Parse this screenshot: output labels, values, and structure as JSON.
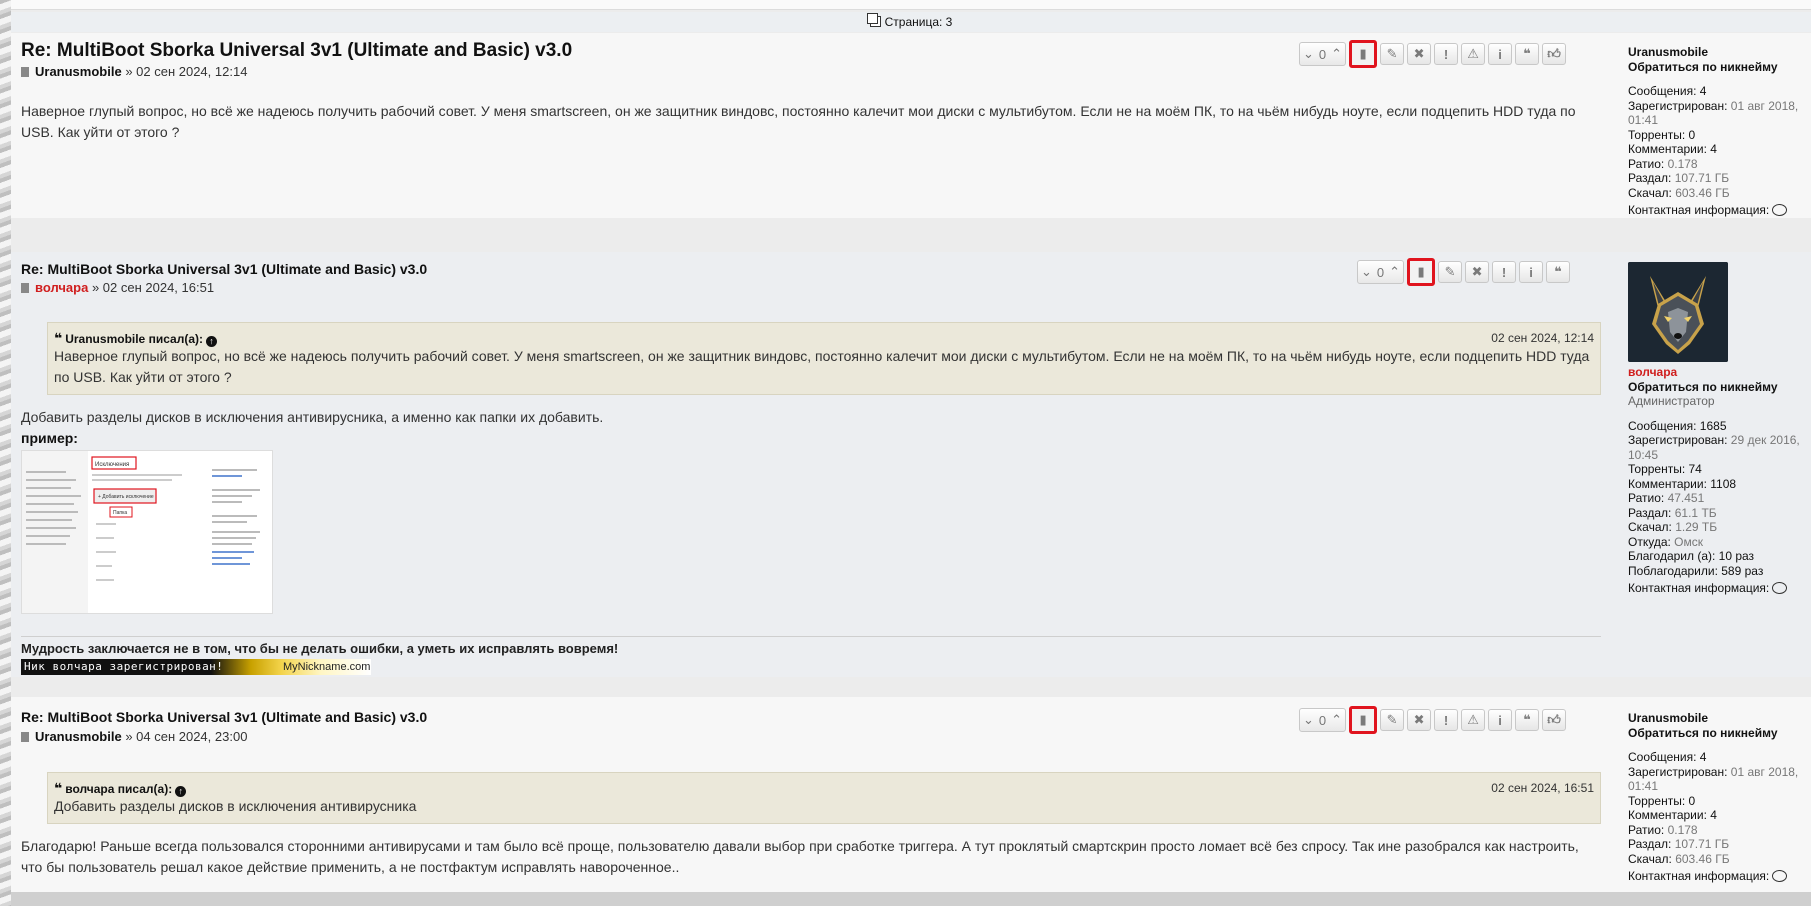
{
  "pagination": {
    "label": "Страница: 3"
  },
  "posts": [
    {
      "title": "Re: MultiBoot Sborka Universal 3v1 (Ultimate and Basic) v3.0",
      "author": "Uranusmobile",
      "date": "» 02 сен 2024, 12:14",
      "vote_count": "0",
      "body": "Наверное глупый вопрос, но всё же надеюсь получить рабочий совет. У меня smartscreen, он же защитник виндовс, постоянно калечит мои диски с мультибутом. Если не на моём ПК, то на чьём нибудь ноуте, если подцепить HDD туда по USB. Как уйти от этого ?",
      "profile": {
        "username": "Uranusmobile",
        "contact_by_nick": "Обратиться по никнейму",
        "messages": "Сообщения: 4",
        "registered_label": "Зарегистрирован:",
        "registered_value": "01 авг 2018, 01:41",
        "torrents": "Торренты: 0",
        "comments": "Комментарии: 4",
        "ratio_label": "Ратио:",
        "ratio_value": "0.178",
        "upload_label": "Раздал:",
        "upload_value": "107.71 ГБ",
        "download_label": "Скачал:",
        "download_value": "603.46 ГБ",
        "contact_info": "Контактная информация:"
      }
    },
    {
      "title": "Re: MultiBoot Sborka Universal 3v1 (Ultimate and Basic) v3.0",
      "author": "волчара",
      "date": "» 02 сен 2024, 16:51",
      "vote_count": "0",
      "quote": {
        "author": "Uranusmobile",
        "wrote": "писал(а):",
        "date": "02 сен 2024, 12:14",
        "text": "Наверное глупый вопрос, но всё же надеюсь получить рабочий совет. У меня smartscreen, он же защитник виндовс, постоянно калечит мои диски с мультибутом. Если не на моём ПК, то на чьём нибудь ноуте, если подцепить HDD туда по USB. Как уйти от этого ?"
      },
      "body": "Добавить разделы дисков в исключения антивирусника, а именно как папки их добавить.",
      "example_label": "пример:",
      "signature_text": "Мудрость заключается не в том, что бы не делать ошибки, а уметь их исправлять вовремя!",
      "signature_banner_nick": "Ник волчара зарегистрирован!",
      "signature_banner_site": "MyNickname.com",
      "profile": {
        "username": "волчара",
        "contact_by_nick": "Обратиться по никнейму",
        "role": "Администратор",
        "messages": "Сообщения: 1685",
        "registered_label": "Зарегистрирован:",
        "registered_value": "29 дек 2016, 10:45",
        "torrents": "Торренты: 74",
        "comments": "Комментарии: 1108",
        "ratio_label": "Ратио:",
        "ratio_value": "47.451",
        "upload_label": "Раздал:",
        "upload_value": "61.1 ТБ",
        "download_label": "Скачал:",
        "download_value": "1.29 ТБ",
        "from_label": "Откуда:",
        "from_value": "Омск",
        "thanked": "Благодарил (а): 10 раз",
        "was_thanked": "Поблагодарили: 589 раз",
        "contact_info": "Контактная информация:"
      }
    },
    {
      "title": "Re: MultiBoot Sborka Universal 3v1 (Ultimate and Basic) v3.0",
      "author": "Uranusmobile",
      "date": "» 04 сен 2024, 23:00",
      "vote_count": "0",
      "quote": {
        "author": "волчара",
        "wrote": "писал(а):",
        "date": "02 сен 2024, 16:51",
        "text": "Добавить разделы дисков в исключения антивирусника"
      },
      "body": "Благодарю! Раньше всегда пользовался сторонними антивирусами и там было всё проще, пользователю давали выбор при сработке триггера. А тут проклятый смартскрин просто ломает всё без спросу. Так ине разобрался как настроить, что бы пользователь решал какое действие применить, а не постфактум исправлять навороченное..",
      "profile": {
        "username": "Uranusmobile",
        "contact_by_nick": "Обратиться по никнейму",
        "messages": "Сообщения: 4",
        "registered_label": "Зарегистрирован:",
        "registered_value": "01 авг 2018, 01:41",
        "torrents": "Торренты: 0",
        "comments": "Комментарии: 4",
        "ratio_label": "Ратио:",
        "ratio_value": "0.178",
        "upload_label": "Раздал:",
        "upload_value": "107.71 ГБ",
        "download_label": "Скачал:",
        "download_value": "603.46 ГБ",
        "contact_info": "Контактная информация:"
      }
    }
  ],
  "screenshot_thumb": {
    "header": "Исключения",
    "add_button": "+ Добавить исключение",
    "menu_item": "Папка"
  },
  "colors": {
    "highlight": "#e0141e",
    "admin_name": "#d01e1e",
    "quote_bg": "#ebe8da"
  },
  "icons": [
    "chevron-down-icon",
    "chevron-up-icon",
    "bookmark-icon",
    "pencil-icon",
    "delete-icon",
    "exclamation-icon",
    "warning-icon",
    "info-icon",
    "quote-icon",
    "thumbs-up-icon",
    "speech-bubble-icon"
  ]
}
